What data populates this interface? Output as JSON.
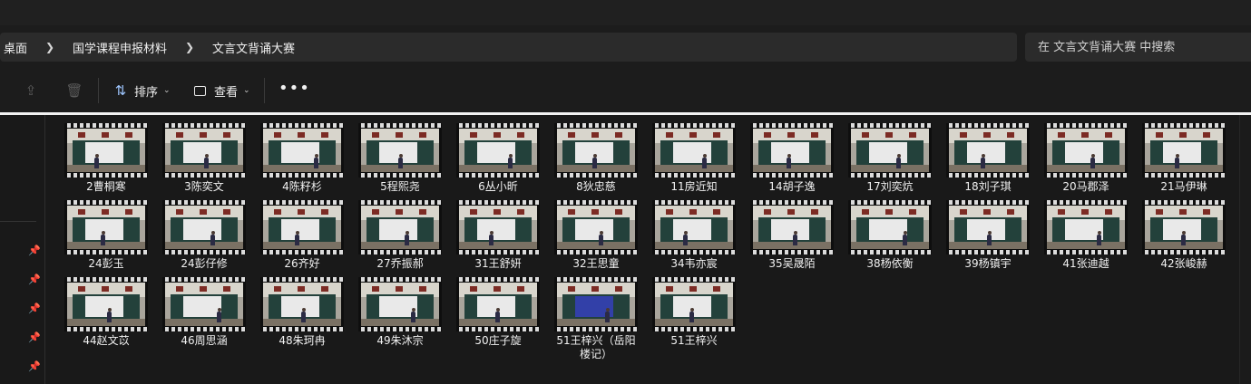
{
  "breadcrumb": [
    "桌面",
    "国学课程申报材料",
    "文言文背诵大赛"
  ],
  "search": {
    "placeholder": "在 文言文背诵大赛 中搜索"
  },
  "toolbar": {
    "sort_label": "排序",
    "view_label": "查看",
    "more_label": "•••"
  },
  "icons": {
    "share": "share-icon",
    "delete": "trash-icon",
    "sort": "sort-arrows-icon",
    "view": "view-icon",
    "pin": "pin-icon",
    "chevron": "chevron-down-icon",
    "separator": "chevron-right-icon"
  },
  "files": [
    [
      "2曹桐寒",
      "3陈奕文",
      "4陈籽杉",
      "5程熙尧",
      "6丛小昕",
      "8狄忠慈",
      "11房近知",
      "14胡子逸",
      "17刘奕炕",
      "18刘子琪",
      "20马郡泽",
      "21马伊琳"
    ],
    [
      "24彭玉",
      "24彭仔修",
      "26齐好",
      "27乔振郝",
      "31王舒妍",
      "32王思童",
      "34韦亦宸",
      "35吴晟陌",
      "38杨依衡",
      "39杨镇宇",
      "41张迪越",
      "42张峻赫"
    ],
    [
      "44赵文苡",
      "46周思涵",
      "48朱珂冉",
      "49朱沐宗",
      "50庄子旋",
      "51王梓兴（岳阳楼记）",
      "51王梓兴"
    ]
  ],
  "colors": {
    "accent": "#9fc6ff",
    "background": "#191919",
    "divider": "#f2f2f2"
  }
}
